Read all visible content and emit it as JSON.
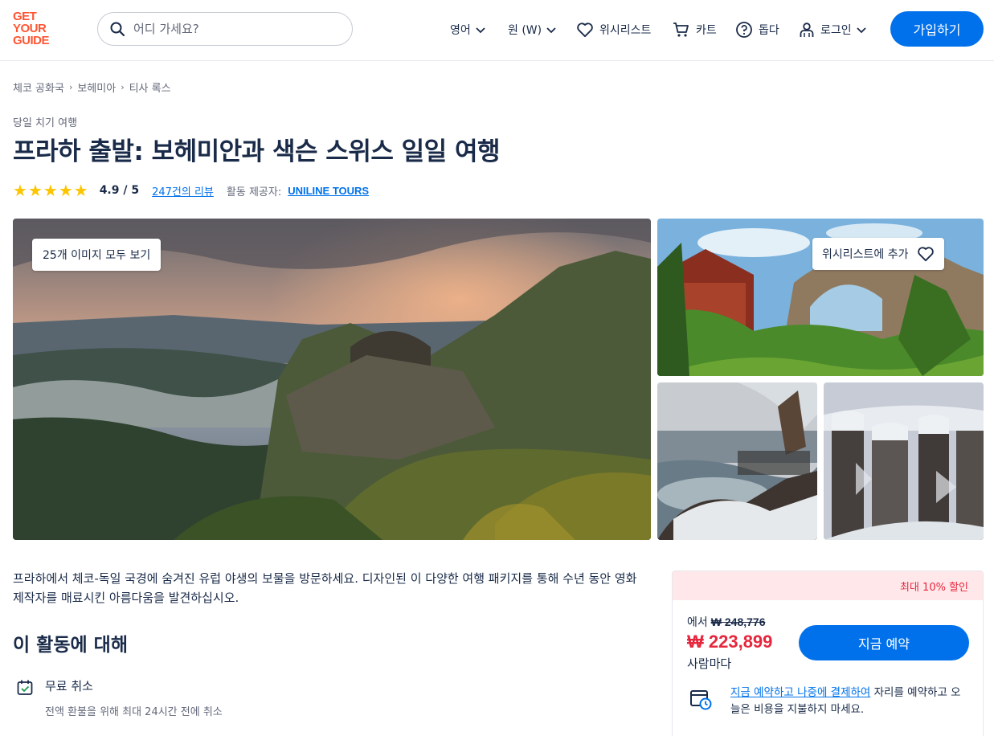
{
  "header": {
    "logo_lines": [
      "GET",
      "YOUR",
      "GUIDE"
    ],
    "search_placeholder": "어디 가세요?",
    "language": "영어",
    "currency": "원 (W)",
    "wishlist": "위시리스트",
    "cart": "카트",
    "help": "돕다",
    "login": "로그인",
    "signup": "가입하기"
  },
  "breadcrumb": [
    "체코 공화국",
    "보헤미아",
    "티사 록스"
  ],
  "category": "당일 치기 여행",
  "title": "프라하 출발: 보헤미안과 색슨 스위스 일일 여행",
  "rating": {
    "stars": 5,
    "value": "4.9 / 5",
    "reviews": "247건의 리뷰",
    "provider_label": "활동 제공자:",
    "provider": "UNILINE TOURS"
  },
  "gallery": {
    "view_all": "25개 이미지 모두 보기",
    "add_wishlist": "위시리스트에 추가"
  },
  "description": "프라하에서 체코-독일 국경에 숨겨진 유럽 야생의 보물을 방문하세요. 디자인된 이 다양한 여행 패키지를 통해 수년 동안 영화 제작자를 매료시킨 아름다움을 발견하십시오.",
  "about": {
    "title": "이 활동에 대해",
    "feature_title": "무료 취소",
    "feature_sub": "전액 환불을 위해 최대 24시간 전에 취소"
  },
  "booking": {
    "discount": "최대 10% 할인",
    "from_label": "에서",
    "old_price": "₩ 248,776",
    "price": "₩ 223,899",
    "per_person": "사람마다",
    "book_button": "지금 예약",
    "reserve_link": "지금 예약하고 나중에 결제하여",
    "reserve_text": " 자리를 예약하고 오늘은 비용을 지불하지 마세요."
  },
  "colors": {
    "brand_orange": "#ff5533",
    "primary_blue": "#0071eb",
    "discount_red": "#e6263c",
    "star_yellow": "#fdc500"
  }
}
